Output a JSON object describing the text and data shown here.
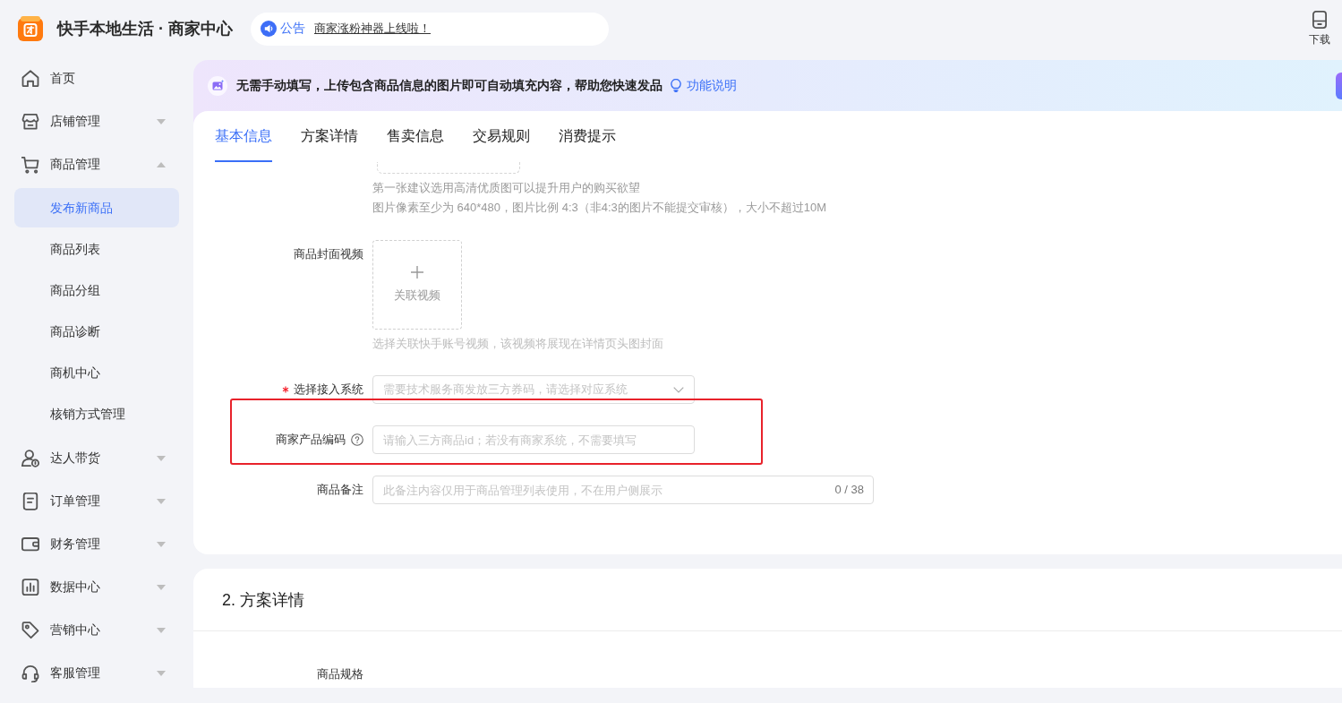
{
  "header": {
    "title": "快手本地生活 · 商家中心",
    "notice": {
      "tag": "公告",
      "text": "商家涨粉神器上线啦！"
    },
    "download": "下载"
  },
  "sidebar": {
    "items": [
      {
        "label": "首页",
        "kind": "link"
      },
      {
        "label": "店铺管理",
        "kind": "group",
        "expanded": false
      },
      {
        "label": "商品管理",
        "kind": "group",
        "expanded": true,
        "children": [
          {
            "label": "发布新商品",
            "selected": true
          },
          {
            "label": "商品列表",
            "selected": false
          },
          {
            "label": "商品分组",
            "selected": false
          },
          {
            "label": "商品诊断",
            "selected": false
          },
          {
            "label": "商机中心",
            "selected": false
          },
          {
            "label": "核销方式管理",
            "selected": false
          }
        ]
      },
      {
        "label": "达人带货",
        "kind": "group",
        "expanded": false
      },
      {
        "label": "订单管理",
        "kind": "group",
        "expanded": false
      },
      {
        "label": "财务管理",
        "kind": "group",
        "expanded": false
      },
      {
        "label": "数据中心",
        "kind": "group",
        "expanded": false
      },
      {
        "label": "营销中心",
        "kind": "group",
        "expanded": false
      },
      {
        "label": "客服管理",
        "kind": "group",
        "expanded": false
      }
    ]
  },
  "banner": {
    "text": "无需手动填写，上传包含商品信息的图片即可自动填充内容，帮助您快速发品",
    "link": "功能说明"
  },
  "tabs": [
    {
      "label": "基本信息",
      "selected": true
    },
    {
      "label": "方案详情",
      "selected": false
    },
    {
      "label": "售卖信息",
      "selected": false
    },
    {
      "label": "交易规则",
      "selected": false
    },
    {
      "label": "消费提示",
      "selected": false
    }
  ],
  "form": {
    "image_hints": [
      "第一张建议选用高清优质图可以提升用户的购买欲望",
      "图片像素至少为 640*480，图片比例 4:3（非4:3的图片不能提交审核），大小不超过10M"
    ],
    "fields": [
      {
        "kind": "video",
        "label": "商品封面视频",
        "required": false,
        "help": false,
        "highlighted": false,
        "button": "关联视频",
        "hint": "选择关联快手账号视频，该视频将展现在详情页头图封面"
      },
      {
        "kind": "select",
        "label": "选择接入系统",
        "required": true,
        "help": false,
        "highlighted": false,
        "placeholder": "需要技术服务商发放三方券码，请选择对应系统"
      },
      {
        "kind": "input",
        "label": "商家产品编码",
        "required": false,
        "help": true,
        "highlighted": true,
        "placeholder": "请输入三方商品id；若没有商家系统，不需要填写"
      },
      {
        "kind": "input",
        "label": "商品备注",
        "required": false,
        "help": false,
        "highlighted": false,
        "placeholder": "此备注内容仅用于商品管理列表使用，不在用户侧展示",
        "counter": "0 / 38"
      }
    ]
  },
  "section_2": {
    "title": "2. 方案详情",
    "fields": [
      {
        "label": "商品规格"
      }
    ]
  }
}
